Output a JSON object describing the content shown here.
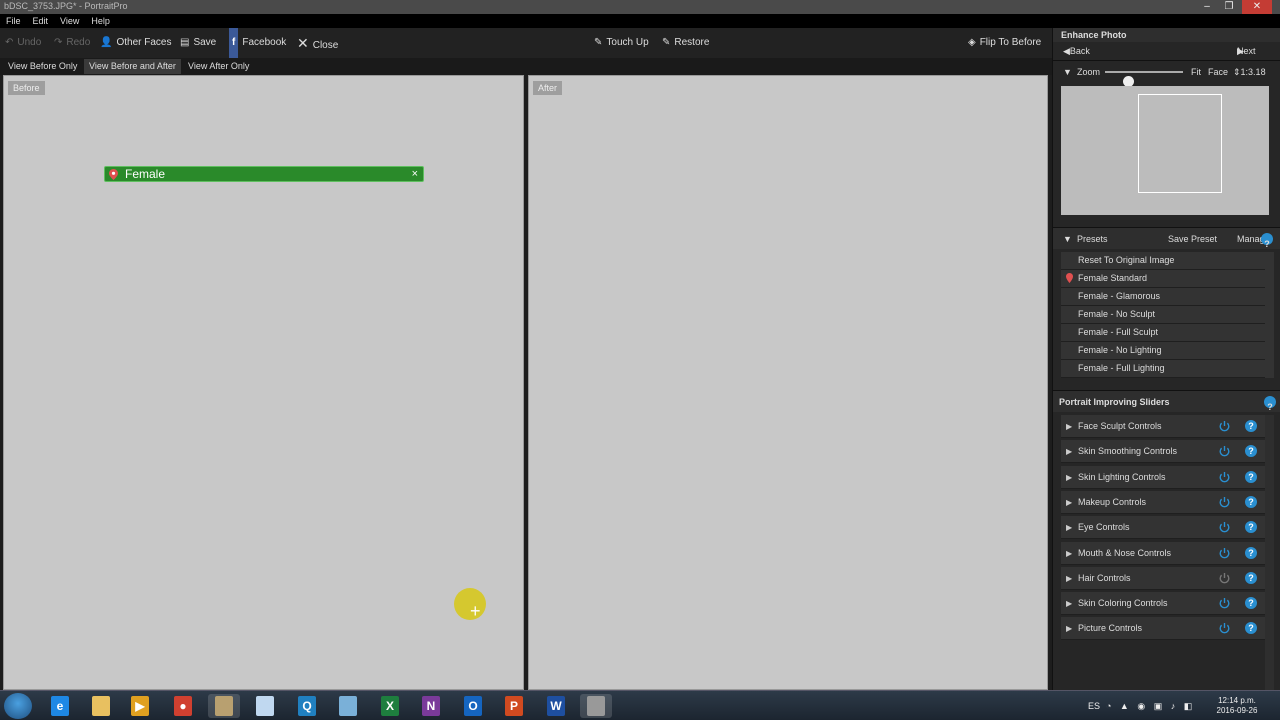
{
  "window": {
    "title": "bDSC_3753.JPG* - PortraitPro",
    "min": "–",
    "max": "❐",
    "close": "✕"
  },
  "menu": [
    "File",
    "Edit",
    "View",
    "Help"
  ],
  "toolbar": {
    "undo": "Undo",
    "redo": "Redo",
    "other_faces": "Other Faces",
    "save": "Save",
    "facebook": "Facebook",
    "close": "Close",
    "touch_up": "Touch Up",
    "restore": "Restore",
    "flip": "Flip To Before"
  },
  "view_modes": [
    "View Before Only",
    "View Before and After",
    "View After Only"
  ],
  "active_view_mode": 1,
  "panels": {
    "before_label": "Before",
    "after_label": "After",
    "face_tag": "Female",
    "face_tag_close": "×"
  },
  "enhance": {
    "title": "Enhance Photo",
    "back": "Back",
    "next": "Next",
    "zoom_label": "Zoom",
    "zoom_level": 0.29,
    "fit": "Fit",
    "face": "Face",
    "ratio": "1:3.18"
  },
  "presets": {
    "header": "Presets",
    "save_preset": "Save Preset",
    "manage": "Manage",
    "items": [
      "Reset To Original Image",
      "Female Standard",
      "Female - Glamorous",
      "Female - No Sculpt",
      "Female - Full Sculpt",
      "Female - No Lighting",
      "Female - Full Lighting"
    ],
    "selected_index": 1
  },
  "sliders": {
    "header": "Portrait Improving Sliders",
    "items": [
      "Face Sculpt Controls",
      "Skin Smoothing Controls",
      "Skin Lighting Controls",
      "Makeup Controls",
      "Eye Controls",
      "Mouth & Nose Controls",
      "Hair Controls",
      "Skin Coloring Controls",
      "Picture Controls"
    ],
    "enabled": [
      true,
      true,
      true,
      true,
      true,
      true,
      false,
      true,
      true
    ]
  },
  "taskbar": {
    "apps": [
      {
        "icon": "internet-explorer-icon",
        "glyph": "e",
        "color": "#1e88e5"
      },
      {
        "icon": "folder-icon",
        "glyph": "",
        "color": "#e8c060"
      },
      {
        "icon": "media-player-icon",
        "glyph": "▶",
        "color": "#e0a020"
      },
      {
        "icon": "chrome-icon",
        "glyph": "●",
        "color": "#d04030"
      },
      {
        "icon": "portraitpro-icon",
        "glyph": "",
        "color": "#b8a070"
      },
      {
        "icon": "notepad-icon",
        "glyph": "",
        "color": "#c0d8f0"
      },
      {
        "icon": "search-app-icon",
        "glyph": "Q",
        "color": "#2080c0"
      },
      {
        "icon": "paint-icon",
        "glyph": "",
        "color": "#7ab0d8"
      },
      {
        "icon": "excel-icon",
        "glyph": "X",
        "color": "#1e7e3e"
      },
      {
        "icon": "onenote-icon",
        "glyph": "N",
        "color": "#7a3a9a"
      },
      {
        "icon": "outlook-icon",
        "glyph": "O",
        "color": "#1565c0"
      },
      {
        "icon": "powerpoint-icon",
        "glyph": "P",
        "color": "#d04a20"
      },
      {
        "icon": "word-icon",
        "glyph": "W",
        "color": "#1e4fa0"
      },
      {
        "icon": "camera-icon",
        "glyph": "",
        "color": "#999999"
      }
    ],
    "language": "ES",
    "time": "12:14 p.m.",
    "date": "2016-09-26"
  },
  "colors": {
    "accent": "#2a8fd0",
    "face_tag": "#2a8a2a",
    "contour": "#5050d0",
    "markers": "#e0c020"
  }
}
